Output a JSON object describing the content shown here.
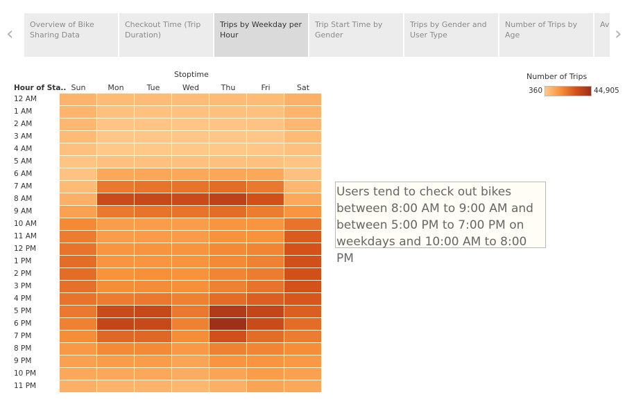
{
  "tabs": [
    {
      "label": "Overview of Bike Sharing Data",
      "active": false
    },
    {
      "label": "Checkout Time (Trip Duration)",
      "active": false
    },
    {
      "label": "Trips by Weekday per Hour",
      "active": true
    },
    {
      "label": "Trip Start Time by Gender",
      "active": false
    },
    {
      "label": "Trips by Gender and User Type",
      "active": false
    },
    {
      "label": "Number of Trips by Age",
      "active": false
    },
    {
      "label": "Ave by",
      "active": false
    }
  ],
  "nav": {
    "prev_icon": "chevron-left-icon",
    "next_icon": "chevron-right-icon"
  },
  "annotation": {
    "text": "Users tend to check out bikes between 8:00 AM to 9:00 AM and between 5:00 PM to 7:00 PM on weekdays and 10:00 AM to 8:00 PM"
  },
  "legend": {
    "title": "Number of Trips",
    "min_label": "360",
    "max_label": "44,905"
  },
  "chart_data": {
    "type": "heatmap",
    "title": "Stoptime",
    "row_header": "Hour of Sta..",
    "columns": [
      "Sun",
      "Mon",
      "Tue",
      "Wed",
      "Thu",
      "Fri",
      "Sat"
    ],
    "rows": [
      "12 AM",
      "1 AM",
      "2 AM",
      "3 AM",
      "4 AM",
      "5 AM",
      "6 AM",
      "7 AM",
      "8 AM",
      "9 AM",
      "10 AM",
      "11 AM",
      "12 PM",
      "1 PM",
      "2 PM",
      "3 PM",
      "4 PM",
      "5 PM",
      "6 PM",
      "7 PM",
      "8 PM",
      "9 PM",
      "10 PM",
      "11 PM"
    ],
    "value_range": [
      360,
      44905
    ],
    "colors": [
      "#ffc88a",
      "#f8913a",
      "#d4521a",
      "#9e2f18"
    ],
    "values": [
      [
        6000,
        4000,
        3800,
        3500,
        3800,
        4000,
        6500
      ],
      [
        5500,
        2500,
        2300,
        2200,
        2400,
        2600,
        5500
      ],
      [
        5000,
        1500,
        1400,
        1300,
        1500,
        1600,
        5000
      ],
      [
        4000,
        900,
        800,
        800,
        900,
        1000,
        4000
      ],
      [
        2500,
        700,
        700,
        700,
        700,
        800,
        2500
      ],
      [
        1500,
        2500,
        2500,
        2500,
        2500,
        2500,
        1500
      ],
      [
        2000,
        9000,
        9500,
        9000,
        9500,
        9000,
        2500
      ],
      [
        4000,
        21000,
        22000,
        22000,
        24000,
        21000,
        5000
      ],
      [
        7000,
        33000,
        34000,
        33000,
        37000,
        31000,
        9000
      ],
      [
        11000,
        21000,
        22000,
        22000,
        24000,
        20000,
        14000
      ],
      [
        17000,
        12000,
        12000,
        12000,
        14000,
        14000,
        22000
      ],
      [
        20000,
        12000,
        12500,
        12500,
        15000,
        15000,
        28000
      ],
      [
        22000,
        14000,
        14500,
        14500,
        17000,
        18000,
        30000
      ],
      [
        24000,
        14000,
        14000,
        14500,
        17000,
        19000,
        31000
      ],
      [
        24000,
        15000,
        15500,
        15000,
        18000,
        20000,
        31000
      ],
      [
        23000,
        16000,
        16500,
        15500,
        19000,
        22000,
        30000
      ],
      [
        22000,
        20000,
        21000,
        19000,
        24000,
        27000,
        29000
      ],
      [
        21000,
        33000,
        34000,
        21000,
        40000,
        35000,
        27000
      ],
      [
        19000,
        35000,
        34000,
        19000,
        44905,
        33000,
        24000
      ],
      [
        16000,
        25000,
        25000,
        16000,
        31000,
        24000,
        20000
      ],
      [
        13000,
        17000,
        17000,
        13000,
        19000,
        18000,
        16000
      ],
      [
        11000,
        12000,
        12000,
        10000,
        14000,
        14000,
        13000
      ],
      [
        9000,
        9000,
        9000,
        8000,
        10000,
        12000,
        11000
      ],
      [
        7000,
        6000,
        6000,
        5000,
        7000,
        10000,
        9000
      ]
    ]
  }
}
